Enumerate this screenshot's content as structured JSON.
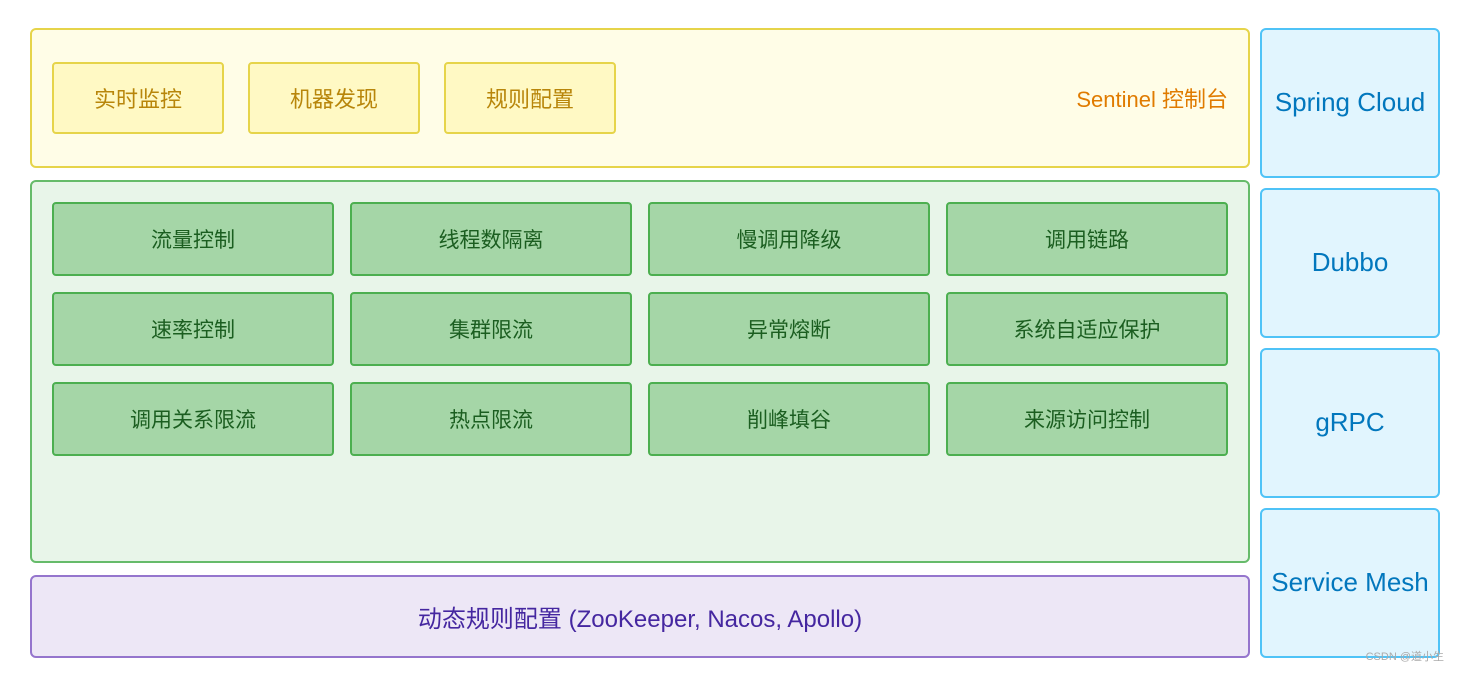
{
  "sentinel": {
    "boxes": [
      "实时监控",
      "机器发现",
      "规则配置"
    ],
    "label": "Sentinel 控制台"
  },
  "features": {
    "rows": [
      [
        "流量控制",
        "线程数隔离",
        "慢调用降级",
        "调用链路"
      ],
      [
        "速率控制",
        "集群限流",
        "异常熔断",
        "系统自适应保护"
      ],
      [
        "调用关系限流",
        "热点限流",
        "削峰填谷",
        "来源访问控制"
      ]
    ]
  },
  "bottom": {
    "label": "动态规则配置 (ZooKeeper, Nacos, Apollo)"
  },
  "right": {
    "items": [
      "Spring\nCloud",
      "Dubbo",
      "gRPC",
      "Service\nMesh"
    ]
  },
  "watermark": "CSDN @道小生"
}
